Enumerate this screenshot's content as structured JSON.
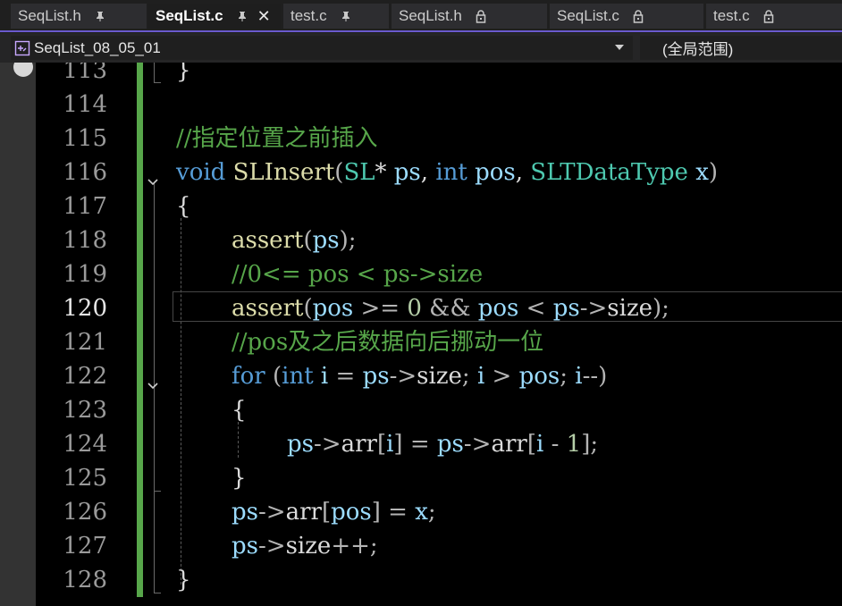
{
  "tabs": [
    {
      "label": "SeqList.h",
      "icon": "pin-icon",
      "active": false
    },
    {
      "label": "SeqList.c",
      "icon": "pin-icon",
      "active": true,
      "close": "✕"
    },
    {
      "label": "test.c",
      "icon": "pin-icon",
      "active": false
    },
    {
      "label": "SeqList.h",
      "icon": "lock-icon",
      "active": false
    },
    {
      "label": "SeqList.c",
      "icon": "lock-icon",
      "active": false
    },
    {
      "label": "test.c",
      "icon": "lock-icon",
      "active": false
    }
  ],
  "navbar": {
    "project": "SeqList_08_05_01",
    "scope": "(全局范围)"
  },
  "editor": {
    "current_line": "120",
    "lines": [
      {
        "n": "113",
        "text": "}"
      },
      {
        "n": "114",
        "text": ""
      },
      {
        "n": "115",
        "text": "//指定位置之前插入"
      },
      {
        "n": "116",
        "text": "void SLInsert(SL* ps, int pos, SLTDataType x)"
      },
      {
        "n": "117",
        "text": "{"
      },
      {
        "n": "118",
        "text": "assert(ps);"
      },
      {
        "n": "119",
        "text": "//0<= pos < ps->size"
      },
      {
        "n": "120",
        "text": "assert(pos >= 0 && pos < ps->size);"
      },
      {
        "n": "121",
        "text": "//pos及之后数据向后挪动一位"
      },
      {
        "n": "122",
        "text": "for (int i = ps->size; i > pos; i--)"
      },
      {
        "n": "123",
        "text": "{"
      },
      {
        "n": "124",
        "text": "ps->arr[i] = ps->arr[i - 1];"
      },
      {
        "n": "125",
        "text": "}"
      },
      {
        "n": "126",
        "text": "ps->arr[pos] = x;"
      },
      {
        "n": "127",
        "text": "ps->size++;"
      },
      {
        "n": "128",
        "text": "}"
      }
    ]
  },
  "colors": {
    "keyword": "#569cd6",
    "function": "#dcdcaa",
    "type": "#4ec9b0",
    "parameter": "#9cdcfe",
    "comment": "#57a64a",
    "number": "#b5cea8",
    "change_bar": "#57a64a",
    "active_tab_underline": "#6a5acd"
  }
}
